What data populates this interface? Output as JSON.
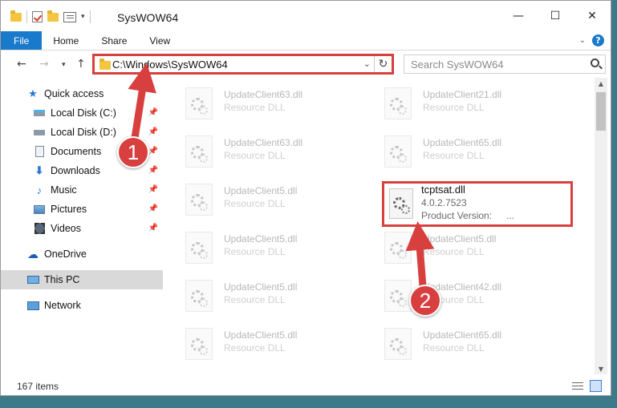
{
  "window": {
    "title": "SysWOW64"
  },
  "ribbon": {
    "tabs": [
      "File",
      "Home",
      "Share",
      "View"
    ]
  },
  "address": {
    "path": "C:\\Windows\\SysWOW64"
  },
  "search": {
    "placeholder": "Search SysWOW64"
  },
  "sidebar": {
    "items": [
      {
        "label": "Quick access",
        "icon": "star-icon"
      },
      {
        "label": "Local Disk (C:)",
        "icon": "drive-icon",
        "pinned": true
      },
      {
        "label": "Local Disk (D:)",
        "icon": "drive-icon",
        "pinned": true
      },
      {
        "label": "Documents",
        "icon": "documents-icon",
        "pinned": true
      },
      {
        "label": "Downloads",
        "icon": "download-icon",
        "pinned": true
      },
      {
        "label": "Music",
        "icon": "music-icon",
        "pinned": true
      },
      {
        "label": "Pictures",
        "icon": "pictures-icon",
        "pinned": true
      },
      {
        "label": "Videos",
        "icon": "videos-icon",
        "pinned": true
      },
      {
        "label": "OneDrive",
        "icon": "cloud-icon"
      },
      {
        "label": "This PC",
        "icon": "computer-icon",
        "selected": true
      },
      {
        "label": "Network",
        "icon": "network-icon"
      }
    ]
  },
  "files": {
    "left": [
      {
        "name": "UpdateClient63.dll",
        "desc": "Resource DLL"
      },
      {
        "name": "UpdateClient63.dll",
        "desc": "Resource DLL"
      },
      {
        "name": "UpdateClient5.dll",
        "desc": "Resource DLL"
      },
      {
        "name": "UpdateClient5.dll",
        "desc": "Resource DLL"
      },
      {
        "name": "UpdateClient5.dll",
        "desc": "Resource DLL"
      },
      {
        "name": "UpdateClient5.dll",
        "desc": "Resource DLL"
      }
    ],
    "right": [
      {
        "name": "UpdateClient21.dll",
        "desc": "Resource DLL"
      },
      {
        "name": "UpdateClient65.dll",
        "desc": "Resource DLL"
      },
      null,
      {
        "name": "UpdateClient5.dll",
        "desc": "Resource DLL"
      },
      {
        "name": "UpdateClient42.dll",
        "desc": "Resource DLL"
      },
      {
        "name": "UpdateClient65.dll",
        "desc": "Resource DLL"
      }
    ],
    "highlighted": {
      "name": "tcptsat.dll",
      "version": "4.0.2.7523",
      "product_version_label": "Product Version:",
      "product_version_value": "..."
    }
  },
  "status": {
    "count": "167 items"
  },
  "annotations": {
    "callout_1": "1",
    "callout_2": "2",
    "color": "#d84040"
  }
}
